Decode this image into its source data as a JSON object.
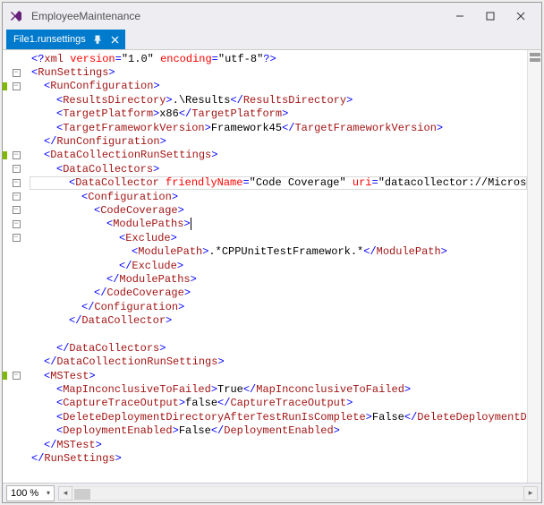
{
  "window": {
    "title": "EmployeeMaintenance"
  },
  "tab": {
    "filename": "File1.runsettings"
  },
  "status": {
    "zoom": "100 %"
  },
  "code": {
    "target_line_index": 9,
    "lines": [
      {
        "indent": 0,
        "fold": "",
        "bar": false,
        "segs": [
          {
            "c": "tok-pi",
            "t": "<?"
          },
          {
            "c": "tok-tag",
            "t": "xml "
          },
          {
            "c": "tok-attr",
            "t": "version"
          },
          {
            "c": "tok-br",
            "t": "="
          },
          {
            "c": "tok-black",
            "t": "\"1.0\" "
          },
          {
            "c": "tok-attr",
            "t": "encoding"
          },
          {
            "c": "tok-br",
            "t": "="
          },
          {
            "c": "tok-black",
            "t": "\"utf-8\""
          },
          {
            "c": "tok-pi",
            "t": "?>"
          }
        ]
      },
      {
        "indent": 0,
        "fold": "-",
        "bar": false,
        "segs": [
          {
            "c": "tok-br",
            "t": "<"
          },
          {
            "c": "tok-tag",
            "t": "RunSettings"
          },
          {
            "c": "tok-br",
            "t": ">"
          }
        ]
      },
      {
        "indent": 1,
        "fold": "-",
        "bar": true,
        "segs": [
          {
            "c": "tok-br",
            "t": "<"
          },
          {
            "c": "tok-tag",
            "t": "RunConfiguration"
          },
          {
            "c": "tok-br",
            "t": ">"
          }
        ]
      },
      {
        "indent": 2,
        "fold": "",
        "bar": true,
        "segs": [
          {
            "c": "tok-br",
            "t": "<"
          },
          {
            "c": "tok-tag",
            "t": "ResultsDirectory"
          },
          {
            "c": "tok-br",
            "t": ">"
          },
          {
            "c": "tok-black",
            "t": ".\\Results"
          },
          {
            "c": "tok-br",
            "t": "</"
          },
          {
            "c": "tok-tag",
            "t": "ResultsDirectory"
          },
          {
            "c": "tok-br",
            "t": ">"
          }
        ]
      },
      {
        "indent": 2,
        "fold": "",
        "bar": true,
        "segs": [
          {
            "c": "tok-br",
            "t": "<"
          },
          {
            "c": "tok-tag",
            "t": "TargetPlatform"
          },
          {
            "c": "tok-br",
            "t": ">"
          },
          {
            "c": "tok-black",
            "t": "x86"
          },
          {
            "c": "tok-br",
            "t": "</"
          },
          {
            "c": "tok-tag",
            "t": "TargetPlatform"
          },
          {
            "c": "tok-br",
            "t": ">"
          }
        ]
      },
      {
        "indent": 2,
        "fold": "",
        "bar": false,
        "segs": [
          {
            "c": "tok-br",
            "t": "<"
          },
          {
            "c": "tok-tag",
            "t": "TargetFrameworkVersion"
          },
          {
            "c": "tok-br",
            "t": ">"
          },
          {
            "c": "tok-black",
            "t": "Framework45"
          },
          {
            "c": "tok-br",
            "t": "</"
          },
          {
            "c": "tok-tag",
            "t": "TargetFrameworkVersion"
          },
          {
            "c": "tok-br",
            "t": ">"
          }
        ]
      },
      {
        "indent": 1,
        "fold": "",
        "bar": false,
        "segs": [
          {
            "c": "tok-br",
            "t": "</"
          },
          {
            "c": "tok-tag",
            "t": "RunConfiguration"
          },
          {
            "c": "tok-br",
            "t": ">"
          }
        ]
      },
      {
        "indent": 1,
        "fold": "-",
        "bar": true,
        "segs": [
          {
            "c": "tok-br",
            "t": "<"
          },
          {
            "c": "tok-tag",
            "t": "DataCollectionRunSettings"
          },
          {
            "c": "tok-br",
            "t": ">"
          }
        ]
      },
      {
        "indent": 2,
        "fold": "-",
        "bar": false,
        "segs": [
          {
            "c": "tok-br",
            "t": "<"
          },
          {
            "c": "tok-tag",
            "t": "DataCollectors"
          },
          {
            "c": "tok-br",
            "t": ">"
          }
        ]
      },
      {
        "indent": 3,
        "fold": "-",
        "bar": false,
        "segs": [
          {
            "c": "tok-br",
            "t": "<"
          },
          {
            "c": "tok-tag",
            "t": "DataCollector "
          },
          {
            "c": "tok-attr",
            "t": "friendlyName"
          },
          {
            "c": "tok-br",
            "t": "="
          },
          {
            "c": "tok-black",
            "t": "\"Code Coverage\" "
          },
          {
            "c": "tok-attr",
            "t": "uri"
          },
          {
            "c": "tok-br",
            "t": "="
          },
          {
            "c": "tok-black",
            "t": "\"datacollector://Microso"
          }
        ]
      },
      {
        "indent": 4,
        "fold": "-",
        "bar": false,
        "segs": [
          {
            "c": "tok-br",
            "t": "<"
          },
          {
            "c": "tok-tag",
            "t": "Configuration"
          },
          {
            "c": "tok-br",
            "t": ">"
          }
        ]
      },
      {
        "indent": 5,
        "fold": "-",
        "bar": false,
        "segs": [
          {
            "c": "tok-br",
            "t": "<"
          },
          {
            "c": "tok-tag",
            "t": "CodeCoverage"
          },
          {
            "c": "tok-br",
            "t": ">"
          }
        ]
      },
      {
        "indent": 6,
        "fold": "-",
        "bar": false,
        "segs": [
          {
            "c": "tok-br",
            "t": "<"
          },
          {
            "c": "tok-tag",
            "t": "ModulePaths"
          },
          {
            "c": "tok-br",
            "t": ">"
          }
        ]
      },
      {
        "indent": 7,
        "fold": "-",
        "bar": false,
        "segs": [
          {
            "c": "tok-br",
            "t": "<"
          },
          {
            "c": "tok-tag",
            "t": "Exclude"
          },
          {
            "c": "tok-br",
            "t": ">"
          }
        ]
      },
      {
        "indent": 8,
        "fold": "",
        "bar": false,
        "segs": [
          {
            "c": "tok-br",
            "t": "<"
          },
          {
            "c": "tok-tag",
            "t": "ModulePath"
          },
          {
            "c": "tok-br",
            "t": ">"
          },
          {
            "c": "tok-black",
            "t": ".*CPPUnitTestFramework.*"
          },
          {
            "c": "tok-br",
            "t": "</"
          },
          {
            "c": "tok-tag",
            "t": "ModulePath"
          },
          {
            "c": "tok-br",
            "t": ">"
          }
        ]
      },
      {
        "indent": 7,
        "fold": "",
        "bar": false,
        "segs": [
          {
            "c": "tok-br",
            "t": "</"
          },
          {
            "c": "tok-tag",
            "t": "Exclude"
          },
          {
            "c": "tok-br",
            "t": ">"
          }
        ]
      },
      {
        "indent": 6,
        "fold": "",
        "bar": false,
        "segs": [
          {
            "c": "tok-br",
            "t": "</"
          },
          {
            "c": "tok-tag",
            "t": "ModulePaths"
          },
          {
            "c": "tok-br",
            "t": ">"
          }
        ]
      },
      {
        "indent": 5,
        "fold": "",
        "bar": false,
        "segs": [
          {
            "c": "tok-br",
            "t": "</"
          },
          {
            "c": "tok-tag",
            "t": "CodeCoverage"
          },
          {
            "c": "tok-br",
            "t": ">"
          }
        ]
      },
      {
        "indent": 4,
        "fold": "",
        "bar": false,
        "segs": [
          {
            "c": "tok-br",
            "t": "</"
          },
          {
            "c": "tok-tag",
            "t": "Configuration"
          },
          {
            "c": "tok-br",
            "t": ">"
          }
        ]
      },
      {
        "indent": 3,
        "fold": "",
        "bar": false,
        "segs": [
          {
            "c": "tok-br",
            "t": "</"
          },
          {
            "c": "tok-tag",
            "t": "DataCollector"
          },
          {
            "c": "tok-br",
            "t": ">"
          }
        ]
      },
      {
        "indent": 3,
        "fold": "",
        "bar": false,
        "segs": []
      },
      {
        "indent": 2,
        "fold": "",
        "bar": false,
        "segs": [
          {
            "c": "tok-br",
            "t": "</"
          },
          {
            "c": "tok-tag",
            "t": "DataCollectors"
          },
          {
            "c": "tok-br",
            "t": ">"
          }
        ]
      },
      {
        "indent": 1,
        "fold": "",
        "bar": false,
        "segs": [
          {
            "c": "tok-br",
            "t": "</"
          },
          {
            "c": "tok-tag",
            "t": "DataCollectionRunSettings"
          },
          {
            "c": "tok-br",
            "t": ">"
          }
        ]
      },
      {
        "indent": 1,
        "fold": "-",
        "bar": true,
        "segs": [
          {
            "c": "tok-br",
            "t": "<"
          },
          {
            "c": "tok-tag",
            "t": "MSTest"
          },
          {
            "c": "tok-br",
            "t": ">"
          }
        ]
      },
      {
        "indent": 2,
        "fold": "",
        "bar": false,
        "segs": [
          {
            "c": "tok-br",
            "t": "<"
          },
          {
            "c": "tok-tag",
            "t": "MapInconclusiveToFailed"
          },
          {
            "c": "tok-br",
            "t": ">"
          },
          {
            "c": "tok-black",
            "t": "True"
          },
          {
            "c": "tok-br",
            "t": "</"
          },
          {
            "c": "tok-tag",
            "t": "MapInconclusiveToFailed"
          },
          {
            "c": "tok-br",
            "t": ">"
          }
        ]
      },
      {
        "indent": 2,
        "fold": "",
        "bar": false,
        "segs": [
          {
            "c": "tok-br",
            "t": "<"
          },
          {
            "c": "tok-tag",
            "t": "CaptureTraceOutput"
          },
          {
            "c": "tok-br",
            "t": ">"
          },
          {
            "c": "tok-black",
            "t": "false"
          },
          {
            "c": "tok-br",
            "t": "</"
          },
          {
            "c": "tok-tag",
            "t": "CaptureTraceOutput"
          },
          {
            "c": "tok-br",
            "t": ">"
          }
        ]
      },
      {
        "indent": 2,
        "fold": "",
        "bar": false,
        "segs": [
          {
            "c": "tok-br",
            "t": "<"
          },
          {
            "c": "tok-tag",
            "t": "DeleteDeploymentDirectoryAfterTestRunIsComplete"
          },
          {
            "c": "tok-br",
            "t": ">"
          },
          {
            "c": "tok-black",
            "t": "False"
          },
          {
            "c": "tok-br",
            "t": "</"
          },
          {
            "c": "tok-tag",
            "t": "DeleteDeploymentDi"
          }
        ]
      },
      {
        "indent": 2,
        "fold": "",
        "bar": false,
        "segs": [
          {
            "c": "tok-br",
            "t": "<"
          },
          {
            "c": "tok-tag",
            "t": "DeploymentEnabled"
          },
          {
            "c": "tok-br",
            "t": ">"
          },
          {
            "c": "tok-black",
            "t": "False"
          },
          {
            "c": "tok-br",
            "t": "</"
          },
          {
            "c": "tok-tag",
            "t": "DeploymentEnabled"
          },
          {
            "c": "tok-br",
            "t": ">"
          }
        ]
      },
      {
        "indent": 1,
        "fold": "",
        "bar": false,
        "segs": [
          {
            "c": "tok-br",
            "t": "</"
          },
          {
            "c": "tok-tag",
            "t": "MSTest"
          },
          {
            "c": "tok-br",
            "t": ">"
          }
        ]
      },
      {
        "indent": 0,
        "fold": "",
        "bar": true,
        "segs": [
          {
            "c": "tok-br",
            "t": "</"
          },
          {
            "c": "tok-tag",
            "t": "RunSettings"
          },
          {
            "c": "tok-br",
            "t": ">"
          }
        ]
      }
    ]
  }
}
